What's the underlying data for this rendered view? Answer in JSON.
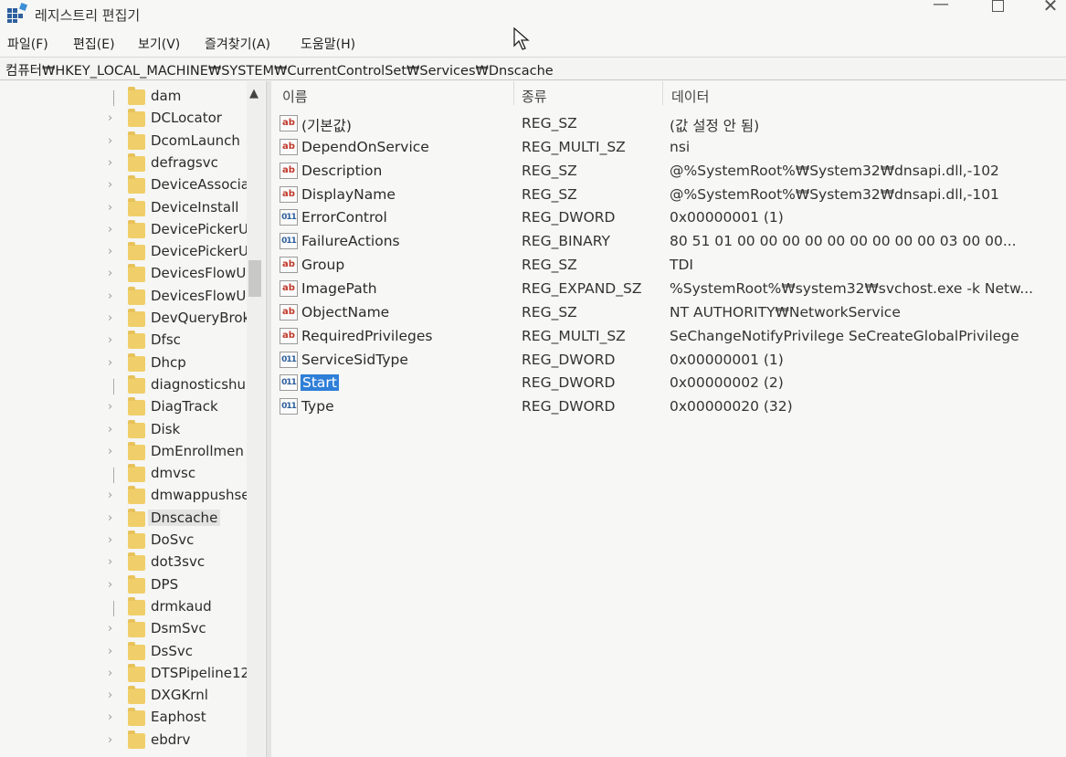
{
  "window": {
    "title": "레지스트리 편집기",
    "icon": "registry-editor-icon"
  },
  "menu": [
    "파일(F)",
    "편집(E)",
    "보기(V)",
    "즐겨찾기(A)",
    "도움말(H)"
  ],
  "address": "컴퓨터₩HKEY_LOCAL_MACHINE₩SYSTEM₩CurrentControlSet₩Services₩Dnscache",
  "tree": {
    "items": [
      {
        "label": "dam",
        "expandable": false
      },
      {
        "label": "DCLocator",
        "expandable": true
      },
      {
        "label": "DcomLaunch",
        "expandable": true
      },
      {
        "label": "defragsvc",
        "expandable": true
      },
      {
        "label": "DeviceAssocia",
        "expandable": true
      },
      {
        "label": "DeviceInstall",
        "expandable": true
      },
      {
        "label": "DevicePickerU",
        "expandable": true
      },
      {
        "label": "DevicePickerU",
        "expandable": true
      },
      {
        "label": "DevicesFlowU",
        "expandable": true
      },
      {
        "label": "DevicesFlowU",
        "expandable": true
      },
      {
        "label": "DevQueryBrok",
        "expandable": true
      },
      {
        "label": "Dfsc",
        "expandable": true
      },
      {
        "label": "Dhcp",
        "expandable": true
      },
      {
        "label": "diagnosticshu",
        "expandable": false
      },
      {
        "label": "DiagTrack",
        "expandable": true
      },
      {
        "label": "Disk",
        "expandable": true
      },
      {
        "label": "DmEnrollmen",
        "expandable": true
      },
      {
        "label": "dmvsc",
        "expandable": false
      },
      {
        "label": "dmwappushse",
        "expandable": true
      },
      {
        "label": "Dnscache",
        "expandable": true,
        "selected": true
      },
      {
        "label": "DoSvc",
        "expandable": true
      },
      {
        "label": "dot3svc",
        "expandable": true
      },
      {
        "label": "DPS",
        "expandable": true
      },
      {
        "label": "drmkaud",
        "expandable": false
      },
      {
        "label": "DsmSvc",
        "expandable": true
      },
      {
        "label": "DsSvc",
        "expandable": true
      },
      {
        "label": "DTSPipeline12",
        "expandable": true
      },
      {
        "label": "DXGKrnl",
        "expandable": true
      },
      {
        "label": "Eaphost",
        "expandable": true
      },
      {
        "label": "ebdrv",
        "expandable": true
      }
    ]
  },
  "list": {
    "columns": {
      "name": "이름",
      "type": "종류",
      "data": "데이터"
    },
    "rows": [
      {
        "icon": "ab",
        "name": "(기본값)",
        "type": "REG_SZ",
        "data": "(값 설정 안 됨)"
      },
      {
        "icon": "ab",
        "name": "DependOnService",
        "type": "REG_MULTI_SZ",
        "data": "nsi"
      },
      {
        "icon": "ab",
        "name": "Description",
        "type": "REG_SZ",
        "data": "@%SystemRoot%₩System32₩dnsapi.dll,-102"
      },
      {
        "icon": "ab",
        "name": "DisplayName",
        "type": "REG_SZ",
        "data": "@%SystemRoot%₩System32₩dnsapi.dll,-101"
      },
      {
        "icon": "bin",
        "name": "ErrorControl",
        "type": "REG_DWORD",
        "data": "0x00000001 (1)"
      },
      {
        "icon": "bin",
        "name": "FailureActions",
        "type": "REG_BINARY",
        "data": "80 51 01 00 00 00 00 00 00 00 00 00 03 00 00..."
      },
      {
        "icon": "ab",
        "name": "Group",
        "type": "REG_SZ",
        "data": "TDI"
      },
      {
        "icon": "ab",
        "name": "ImagePath",
        "type": "REG_EXPAND_SZ",
        "data": "%SystemRoot%₩system32₩svchost.exe -k Netw..."
      },
      {
        "icon": "ab",
        "name": "ObjectName",
        "type": "REG_SZ",
        "data": "NT AUTHORITY₩NetworkService"
      },
      {
        "icon": "ab",
        "name": "RequiredPrivileges",
        "type": "REG_MULTI_SZ",
        "data": "SeChangeNotifyPrivilege SeCreateGlobalPrivilege"
      },
      {
        "icon": "bin",
        "name": "ServiceSidType",
        "type": "REG_DWORD",
        "data": "0x00000001 (1)"
      },
      {
        "icon": "bin",
        "name": "Start",
        "type": "REG_DWORD",
        "data": "0x00000002 (2)",
        "selected": true
      },
      {
        "icon": "bin",
        "name": "Type",
        "type": "REG_DWORD",
        "data": "0x00000020 (32)"
      }
    ]
  },
  "colors": {
    "selection": "#2f7fd8",
    "folder": "#f0cf6a",
    "string_icon": "#c0392b",
    "binary_icon": "#2e5f9e"
  }
}
